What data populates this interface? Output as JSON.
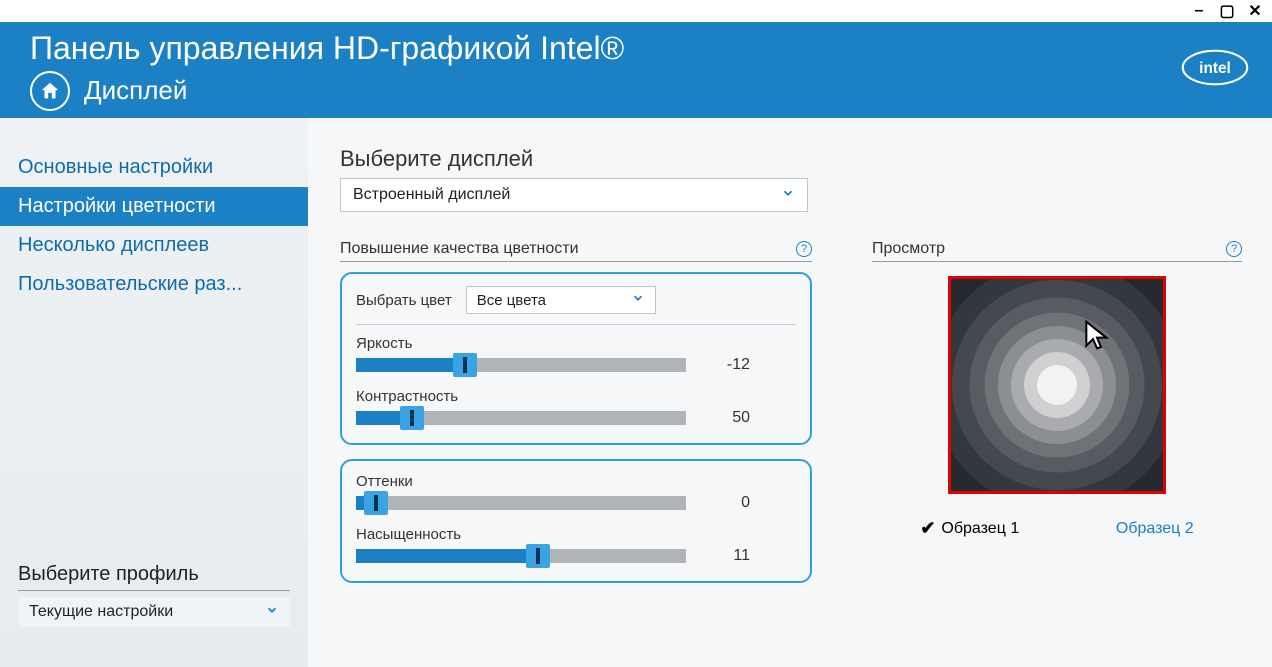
{
  "app_title": "Панель управления HD-графикой Intel®",
  "section_name": "Дисплей",
  "sidebar": {
    "items": [
      {
        "label": "Основные настройки",
        "active": false
      },
      {
        "label": "Настройки цветности",
        "active": true
      },
      {
        "label": "Несколько дисплеев",
        "active": false
      },
      {
        "label": "Пользовательские раз...",
        "active": false
      }
    ],
    "profile_label": "Выберите профиль",
    "profile_value": "Текущие настройки"
  },
  "main": {
    "display_label": "Выберите дисплей",
    "display_value": "Встроенный дисплей",
    "color_group_title": "Повышение качества цветности",
    "color_select_label": "Выбрать цвет",
    "color_select_value": "Все цвета",
    "sliders": {
      "brightness": {
        "label": "Яркость",
        "value": -12,
        "min": -100,
        "max": 100
      },
      "contrast": {
        "label": "Контрастность",
        "value": 50,
        "min": 0,
        "max": 100
      },
      "hue": {
        "label": "Оттенки",
        "value": 0,
        "min": -180,
        "max": 180
      },
      "saturation": {
        "label": "Насыщенность",
        "value": 11,
        "min": -100,
        "max": 100
      }
    },
    "preview_label": "Просмотр",
    "samples": [
      {
        "label": "Образец 1",
        "active": true
      },
      {
        "label": "Образец 2",
        "active": false
      }
    ]
  }
}
